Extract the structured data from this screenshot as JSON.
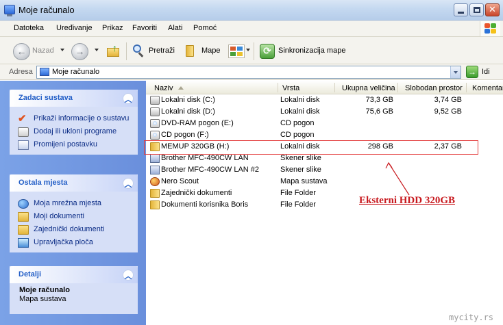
{
  "window": {
    "title": "Moje računalo"
  },
  "menu": [
    "Datoteka",
    "Uređivanje",
    "Prikaz",
    "Favoriti",
    "Alati",
    "Pomoć"
  ],
  "toolbar": {
    "back": "Nazad",
    "search": "Pretraži",
    "folders": "Mape",
    "sync": "Sinkronizacija mape"
  },
  "address": {
    "label": "Adresa",
    "value": "Moje računalo",
    "go": "Idi"
  },
  "left_pane": {
    "system_tasks": {
      "title": "Zadaci sustava",
      "items": [
        "Prikaži informacije o sustavu",
        "Dodaj ili ukloni programe",
        "Promijeni postavku"
      ]
    },
    "other_places": {
      "title": "Ostala mjesta",
      "items": [
        "Moja mrežna mjesta",
        "Moji dokumenti",
        "Zajednički dokumenti",
        "Upravljačka ploča"
      ]
    },
    "details": {
      "title": "Detalji",
      "name": "Moje računalo",
      "type": "Mapa sustava"
    }
  },
  "columns": [
    "Naziv",
    "Vrsta",
    "Ukupna veličina",
    "Slobodan prostor",
    "Komentar"
  ],
  "files": [
    {
      "name": "Lokalni disk (C:)",
      "type": "Lokalni disk",
      "total": "73,3 GB",
      "free": "3,74 GB",
      "icon": "hard-drive-icon"
    },
    {
      "name": "Lokalni disk (D:)",
      "type": "Lokalni disk",
      "total": "75,6 GB",
      "free": "9,52 GB",
      "icon": "hard-drive-icon"
    },
    {
      "name": "DVD-RAM pogon (E:)",
      "type": "CD pogon",
      "total": "",
      "free": "",
      "icon": "cd-drive-icon"
    },
    {
      "name": "CD pogon (F:)",
      "type": "CD pogon",
      "total": "",
      "free": "",
      "icon": "cd-drive-icon"
    },
    {
      "name": "MEMUP 320GB (H:)",
      "type": "Lokalni disk",
      "total": "298 GB",
      "free": "2,37 GB",
      "icon": "folder-icon"
    },
    {
      "name": "Brother MFC-490CW LAN",
      "type": "Skener slike",
      "total": "",
      "free": "",
      "icon": "scanner-icon"
    },
    {
      "name": "Brother MFC-490CW LAN #2",
      "type": "Skener slike",
      "total": "",
      "free": "",
      "icon": "scanner-icon"
    },
    {
      "name": "Nero Scout",
      "type": "Mapa sustava",
      "total": "",
      "free": "",
      "icon": "nero-icon"
    },
    {
      "name": "Zajednički dokumenti",
      "type": "File Folder",
      "total": "",
      "free": "",
      "icon": "folder-icon"
    },
    {
      "name": "Dokumenti korisnika Boris",
      "type": "File Folder",
      "total": "",
      "free": "",
      "icon": "folder-icon"
    }
  ],
  "annotation": {
    "text": "Eksterni HDD 320GB",
    "color": "#c8191e"
  },
  "watermark": "mycity.rs"
}
